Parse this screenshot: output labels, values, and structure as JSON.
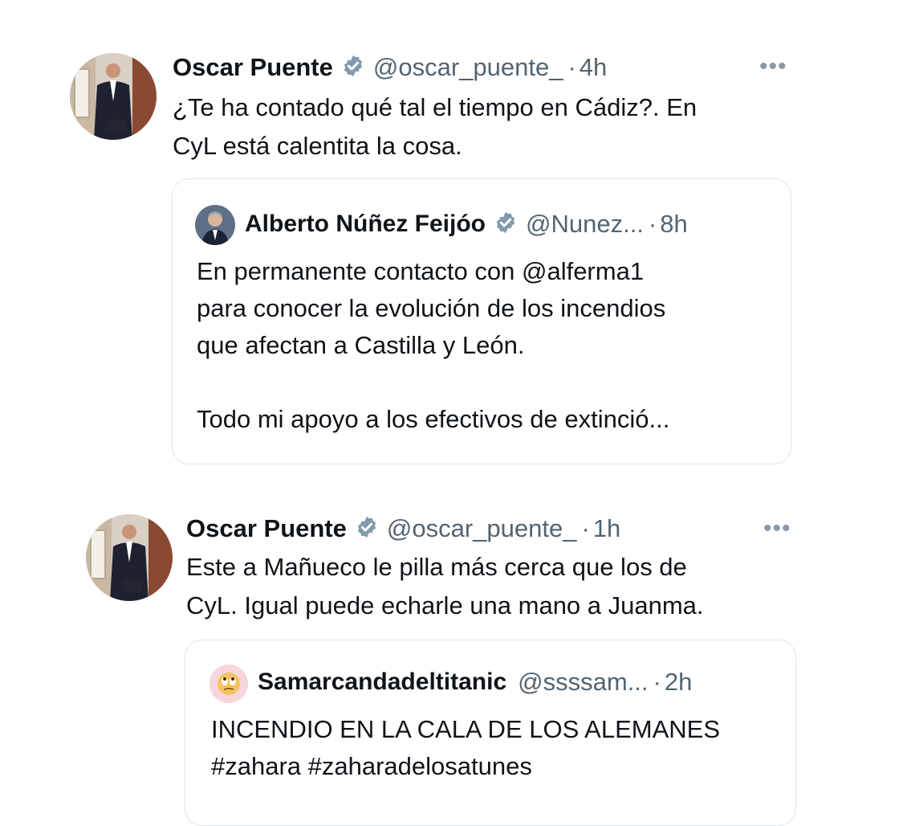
{
  "tweets": [
    {
      "author_name": "Oscar Puente",
      "handle": "@oscar_puente_",
      "separator": "·",
      "time": "4h",
      "text": "¿Te ha contado qué tal el tiempo en Cádiz?. En\nCyL está calentita la cosa.",
      "more_label": "•••",
      "quote": {
        "author_name": "Alberto Núñez Feijóo",
        "handle": "@Nunez...",
        "separator": "·",
        "time": "8h",
        "text": "En permanente contacto con @alferma1\npara conocer la evolución de los incendios\nque afectan a Castilla y León.\n\nTodo mi apoyo a los efectivos de extinció..."
      }
    },
    {
      "author_name": "Oscar Puente",
      "handle": "@oscar_puente_",
      "separator": "·",
      "time": "1h",
      "text": "Este a Mañueco le pilla más cerca que los de\nCyL. Igual puede echarle una mano a Juanma.",
      "more_label": "•••",
      "quote": {
        "author_name": "Samarcandadeltitanic",
        "handle": "@ssssam...",
        "separator": "·",
        "time": "2h",
        "text": "INCENDIO EN LA CALA DE LOS ALEMANES\n#zahara #zaharadelosatunes"
      }
    }
  ],
  "colors": {
    "text": "#0f1419",
    "secondary": "#536471",
    "verified": "#829aab",
    "border": "#e1e6ea"
  },
  "icons": {
    "verified": "verified-badge-icon",
    "more": "more-options-icon",
    "emoji_avatar": "rolling-eyes-emoji-icon"
  }
}
